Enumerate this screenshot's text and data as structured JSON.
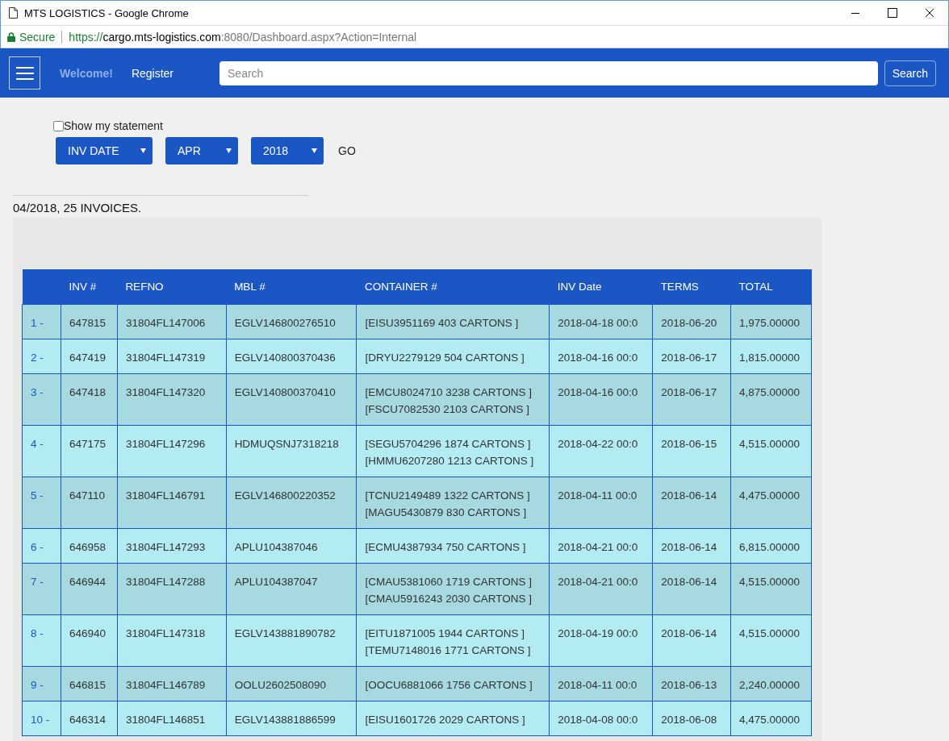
{
  "window": {
    "title": "MTS LOGISTICS - Google Chrome"
  },
  "address_bar": {
    "secure_label": "Secure",
    "url_scheme": "https://",
    "url_host": "cargo.mts-logistics.com",
    "url_rest": ":8080/Dashboard.aspx?Action=Internal"
  },
  "navbar": {
    "welcome": "Welcome!",
    "register": "Register",
    "search": {
      "placeholder": "Search"
    },
    "search_button": "Search"
  },
  "filters": {
    "show_statement": {
      "label": "Show my statement",
      "checked": false
    },
    "dropdowns": [
      "INV DATE",
      "APR",
      "2018"
    ],
    "go": "GO"
  },
  "summary": "04/2018, 25 INVOICES.",
  "table": {
    "columns": [
      "",
      "INV #",
      "REFNO",
      "MBL #",
      "CONTAINER #",
      "INV Date",
      "TERMS",
      "TOTAL"
    ],
    "rows": [
      {
        "number": "1 -",
        "inv": "647815",
        "refno": "31804FL147006",
        "mbl": "EGLV146800276510",
        "containers": [
          "[EISU3951169 403 CARTONS ]"
        ],
        "inv_date": "2018-04-18 00:0",
        "terms": "2018-06-20",
        "total": "1,975.00000"
      },
      {
        "number": "2 -",
        "inv": "647419",
        "refno": "31804FL147319",
        "mbl": "EGLV140800370436",
        "containers": [
          "[DRYU2279129 504 CARTONS ]"
        ],
        "inv_date": "2018-04-16 00:0",
        "terms": "2018-06-17",
        "total": "1,815.00000"
      },
      {
        "number": "3 -",
        "inv": "647418",
        "refno": "31804FL147320",
        "mbl": "EGLV140800370410",
        "containers": [
          "[EMCU8024710 3238 CARTONS ]",
          "[FSCU7082530 2103 CARTONS ]"
        ],
        "inv_date": "2018-04-16 00:0",
        "terms": "2018-06-17",
        "total": "4,875.00000"
      },
      {
        "number": "4 -",
        "inv": "647175",
        "refno": "31804FL147296",
        "mbl": "HDMUQSNJ7318218",
        "containers": [
          "[SEGU5704296 1874 CARTONS ]",
          "[HMMU6207280 1213 CARTONS ]"
        ],
        "inv_date": "2018-04-22 00:0",
        "terms": "2018-06-15",
        "total": "4,515.00000"
      },
      {
        "number": "5 -",
        "inv": "647110",
        "refno": "31804FL146791",
        "mbl": "EGLV146800220352",
        "containers": [
          "[TCNU2149489 1322 CARTONS ]",
          "[MAGU5430879 830 CARTONS ]"
        ],
        "inv_date": "2018-04-11 00:0",
        "terms": "2018-06-14",
        "total": "4,475.00000"
      },
      {
        "number": "6 -",
        "inv": "646958",
        "refno": "31804FL147293",
        "mbl": "APLU104387046",
        "containers": [
          "[ECMU4387934 750 CARTONS ]"
        ],
        "inv_date": "2018-04-21 00:0",
        "terms": "2018-06-14",
        "total": "6,815.00000"
      },
      {
        "number": "7 -",
        "inv": "646944",
        "refno": "31804FL147288",
        "mbl": "APLU104387047",
        "containers": [
          "[CMAU5381060 1719 CARTONS ]",
          "[CMAU5916243 2030 CARTONS ]"
        ],
        "inv_date": "2018-04-21 00:0",
        "terms": "2018-06-14",
        "total": "4,515.00000"
      },
      {
        "number": "8 -",
        "inv": "646940",
        "refno": "31804FL147318",
        "mbl": "EGLV143881890782",
        "containers": [
          "[EITU1871005 1944 CARTONS ]",
          "[TEMU7148016 1771 CARTONS ]"
        ],
        "inv_date": "2018-04-19 00:0",
        "terms": "2018-06-14",
        "total": "4,515.00000"
      },
      {
        "number": "9 -",
        "inv": "646815",
        "refno": "31804FL146789",
        "mbl": "OOLU2602508090",
        "containers": [
          "[OOCU6881066 1756 CARTONS ]"
        ],
        "inv_date": "2018-04-11 00:0",
        "terms": "2018-06-13",
        "total": "2,240.00000"
      },
      {
        "number": "10 -",
        "inv": "646314",
        "refno": "31804FL146851",
        "mbl": "EGLV143881886599",
        "containers": [
          "[EISU1601726 2029 CARTONS ]"
        ],
        "inv_date": "2018-04-08 00:0",
        "terms": "2018-06-08",
        "total": "4,475.00000"
      }
    ]
  }
}
